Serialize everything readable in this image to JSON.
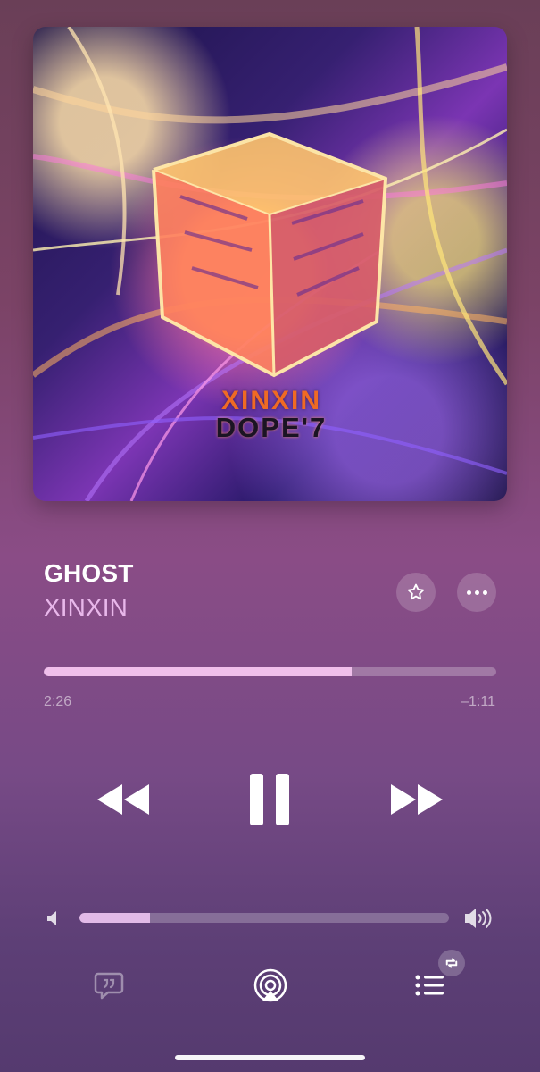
{
  "album": {
    "logo_text_top": "XINXIN",
    "logo_text_bottom": "DOPE'7"
  },
  "track": {
    "title": "GHOST",
    "artist": "XINXIN"
  },
  "progress": {
    "elapsed": "2:26",
    "remaining": "–1:11",
    "fraction": 0.68
  },
  "volume": {
    "fraction": 0.19
  },
  "icons": {
    "favorite": "star-icon",
    "more": "more-icon",
    "rewind": "rewind-icon",
    "pause": "pause-icon",
    "fast_forward": "fast-forward-icon",
    "volume_min": "volume-min-icon",
    "volume_max": "volume-max-icon",
    "lyrics": "lyrics-icon",
    "airplay": "airplay-icon",
    "queue": "queue-icon",
    "repeat": "repeat-icon"
  },
  "colors": {
    "accent_pink": "#e8b7ea",
    "progress_fill": "#f0bfeb",
    "volume_fill": "#e2bae8"
  }
}
